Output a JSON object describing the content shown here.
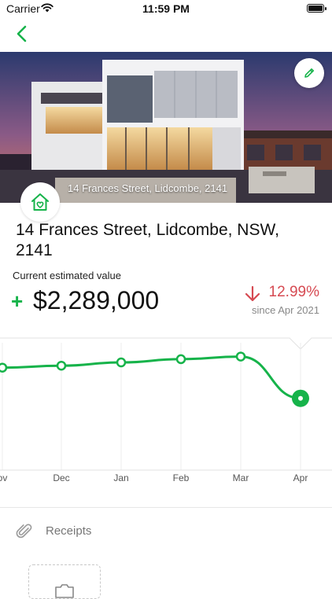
{
  "status_bar": {
    "carrier": "Carrier",
    "time": "11:59 PM"
  },
  "property": {
    "caption": "14 Frances Street, Lidcombe, 2141",
    "address": "14 Frances Street, Lidcombe, NSW, 2141"
  },
  "valuation": {
    "label": "Current estimated value",
    "amount": "$2,289,000",
    "change_percent": "12.99%",
    "change_since": "since Apr 2021",
    "accent_color": "#16b34a",
    "negative_color": "#d64a52"
  },
  "chart_data": {
    "type": "line",
    "categories": [
      "Nov",
      "Dec",
      "Jan",
      "Feb",
      "Mar",
      "Apr"
    ],
    "tick_labels": [
      "ov",
      "Dec",
      "Jan",
      "Feb",
      "Mar",
      "Apr"
    ],
    "series": [
      {
        "values": [
          0.785,
          0.8,
          0.825,
          0.85,
          0.87,
          0.55
        ]
      }
    ],
    "ylim": [
      0,
      1
    ],
    "grid": true,
    "highlighted_index": 5
  },
  "receipts": {
    "label": "Receipts"
  },
  "icons": {
    "back": "chevron-left-icon",
    "edit": "pencil-icon",
    "home": "home-heart-icon",
    "receipts": "paperclip-icon",
    "add_receipt": "camera-icon"
  }
}
